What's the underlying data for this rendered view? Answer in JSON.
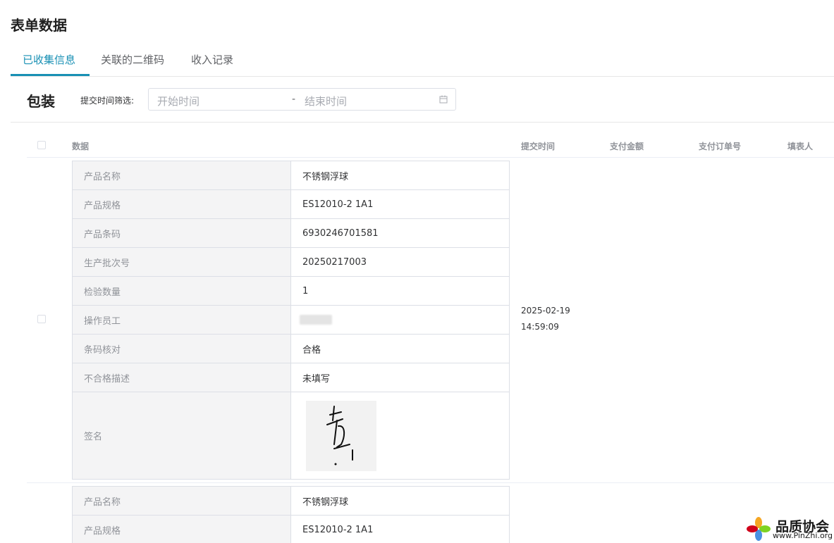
{
  "page": {
    "title": "表单数据"
  },
  "tabs": [
    {
      "label": "已收集信息",
      "active": true
    },
    {
      "label": "关联的二维码",
      "active": false
    },
    {
      "label": "收入记录",
      "active": false
    }
  ],
  "section": {
    "title": "包装"
  },
  "filter": {
    "label": "提交时间筛选:",
    "start_placeholder": "开始时间",
    "separator": "-",
    "end_placeholder": "结束时间",
    "icon": "calendar-icon"
  },
  "table": {
    "columns": [
      "数据",
      "提交时间",
      "支付金额",
      "支付订单号",
      "填表人"
    ],
    "records": [
      {
        "submit_date": "2025-02-19",
        "submit_time": "14:59:09",
        "fields": [
          {
            "key": "产品名称",
            "value": "不锈钢浮球"
          },
          {
            "key": "产品规格",
            "value": "ES12010-2 1A1"
          },
          {
            "key": "产品条码",
            "value": "6930246701581"
          },
          {
            "key": "生产批次号",
            "value": "20250217003"
          },
          {
            "key": "检验数量",
            "value": "1"
          },
          {
            "key": "操作员工",
            "value": ""
          },
          {
            "key": "条码核对",
            "value": "合格"
          },
          {
            "key": "不合格描述",
            "value": "未填写"
          },
          {
            "key": "签名",
            "value": ""
          }
        ]
      },
      {
        "fields": [
          {
            "key": "产品名称",
            "value": "不锈钢浮球"
          },
          {
            "key": "产品规格",
            "value": "ES12010-2 1A1"
          }
        ]
      }
    ]
  },
  "watermark": {
    "name": "品质协会",
    "url": "www.PinZhi.org"
  },
  "colors": {
    "accent": "#1890b4",
    "border": "#dcdfe6",
    "key_bg": "#f4f4f5"
  }
}
